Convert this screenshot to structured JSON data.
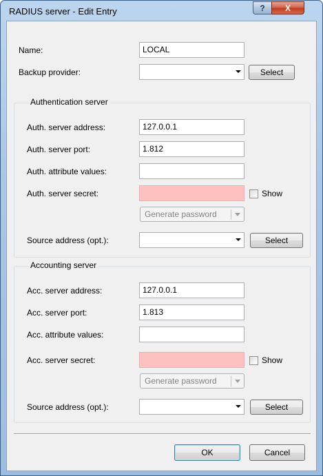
{
  "window": {
    "title": "RADIUS server - Edit Entry",
    "help_glyph": "?",
    "close_glyph": "X"
  },
  "general": {
    "name_label": "Name:",
    "name_value": "LOCAL",
    "backup_label": "Backup provider:",
    "backup_value": "",
    "backup_select": "Select"
  },
  "auth": {
    "group_title": "Authentication server",
    "address_label": "Auth. server address:",
    "address_value": "127.0.0.1",
    "port_label": "Auth. server port:",
    "port_value": "1.812",
    "attr_label": "Auth. attribute values:",
    "attr_value": "",
    "secret_label": "Auth. server secret:",
    "secret_value": "",
    "show_label": "Show",
    "generate_label": "Generate password",
    "source_label": "Source address (opt.):",
    "source_value": "",
    "source_select": "Select"
  },
  "acc": {
    "group_title": "Accounting server",
    "address_label": "Acc. server address:",
    "address_value": "127.0.0.1",
    "port_label": "Acc. server port:",
    "port_value": "1.813",
    "attr_label": "Acc. attribute values:",
    "attr_value": "",
    "secret_label": "Acc. server secret:",
    "secret_value": "",
    "show_label": "Show",
    "generate_label": "Generate password",
    "source_label": "Source address (opt.):",
    "source_value": "",
    "source_select": "Select"
  },
  "footer": {
    "ok": "OK",
    "cancel": "Cancel"
  },
  "colors": {
    "secret_field": "#ffc0c0",
    "title_bar": "#a9c6e6",
    "close_button": "#c23b20"
  }
}
